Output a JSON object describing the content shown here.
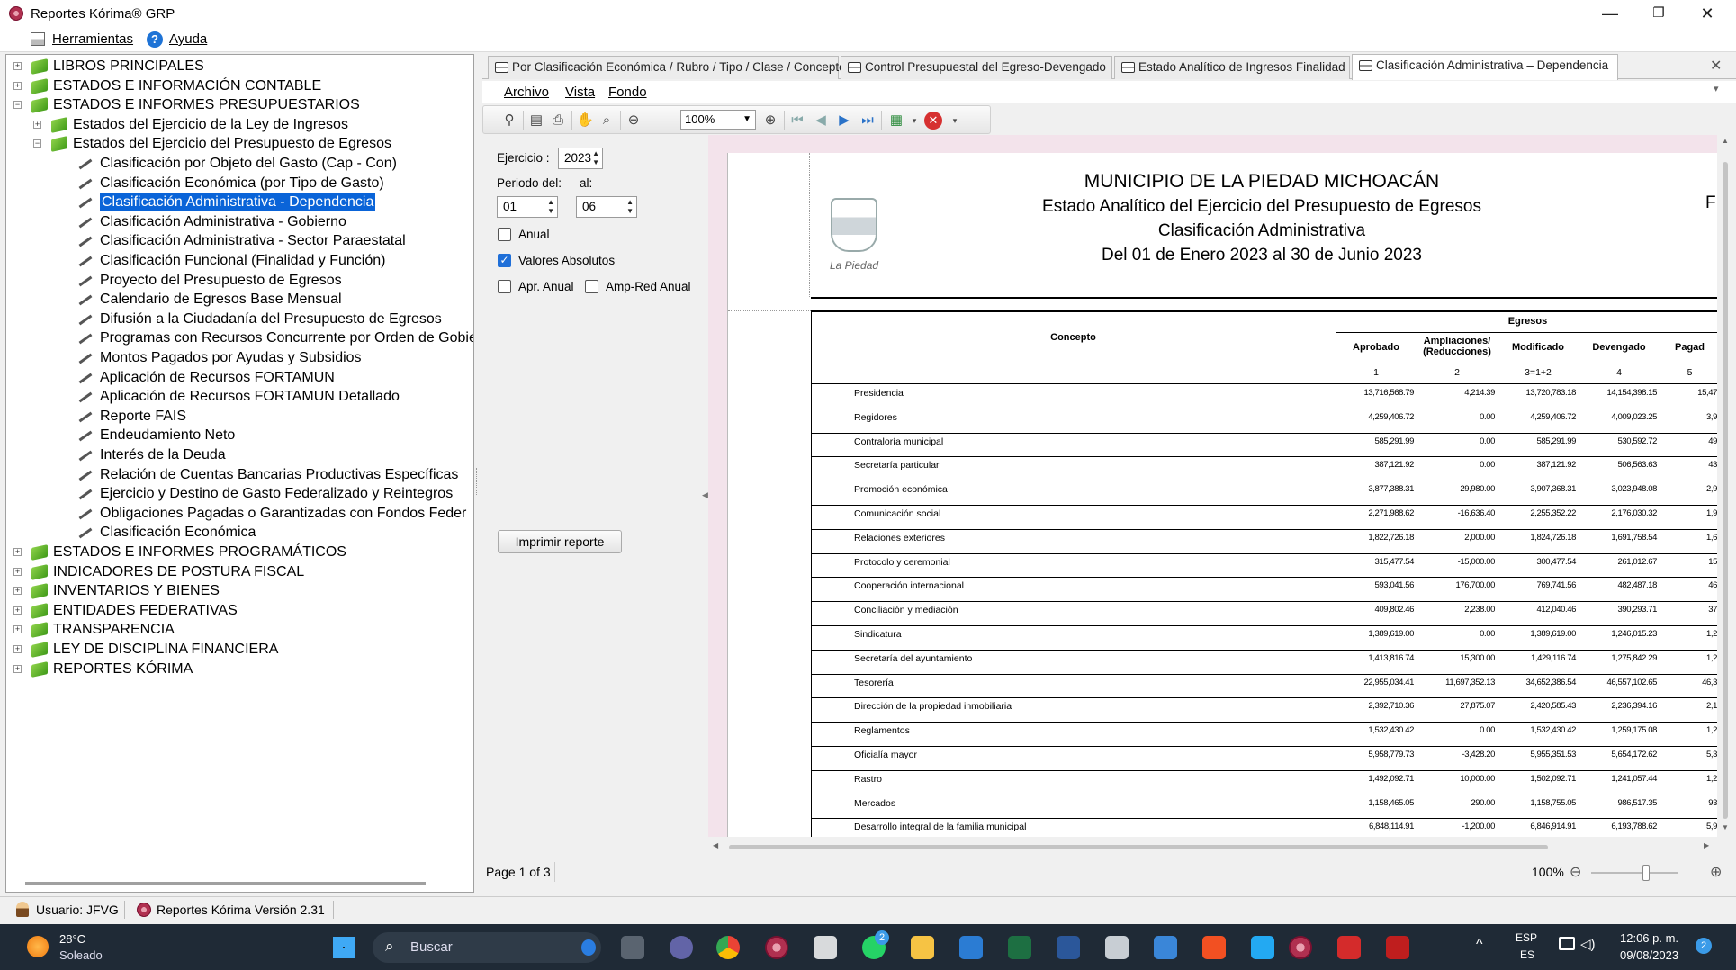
{
  "window": {
    "title": "Reportes Kórima® GRP",
    "minimize": "—",
    "maximize": "❐",
    "close": "✕"
  },
  "menu": {
    "tools": "Herramientas",
    "help": "Ayuda"
  },
  "tree": [
    {
      "label": "LIBROS PRINCIPALES",
      "level": 0,
      "expander": "+",
      "type": "book"
    },
    {
      "label": "ESTADOS E INFORMACIÓN CONTABLE",
      "level": 0,
      "expander": "+",
      "type": "book"
    },
    {
      "label": "ESTADOS E INFORMES PRESUPUESTARIOS",
      "level": 0,
      "expander": "−",
      "type": "book"
    },
    {
      "label": "Estados del Ejercicio de la Ley de Ingresos",
      "level": 1,
      "expander": "+",
      "type": "book"
    },
    {
      "label": "Estados del Ejercicio del Presupuesto de Egresos",
      "level": 1,
      "expander": "−",
      "type": "book"
    },
    {
      "label": "Clasificación por Objeto del Gasto (Cap -  Con)",
      "level": 2,
      "type": "pen"
    },
    {
      "label": "Clasificación Económica (por Tipo de Gasto)",
      "level": 2,
      "type": "pen"
    },
    {
      "label": "Clasificación Administrativa - Dependencia",
      "level": 2,
      "type": "pen",
      "selected": true
    },
    {
      "label": "Clasificación Administrativa - Gobierno",
      "level": 2,
      "type": "pen"
    },
    {
      "label": "Clasificación Administrativa - Sector Paraestatal",
      "level": 2,
      "type": "pen"
    },
    {
      "label": "Clasificación Funcional (Finalidad y Función)",
      "level": 2,
      "type": "pen"
    },
    {
      "label": "Proyecto del Presupuesto de Egresos",
      "level": 2,
      "type": "pen"
    },
    {
      "label": "Calendario de Egresos Base Mensual",
      "level": 2,
      "type": "pen"
    },
    {
      "label": "Difusión a la Ciudadanía del Presupuesto de Egresos",
      "level": 2,
      "type": "pen"
    },
    {
      "label": "Programas con Recursos Concurrente por Orden de Gobie",
      "level": 2,
      "type": "pen"
    },
    {
      "label": "Montos Pagados por Ayudas y Subsidios",
      "level": 2,
      "type": "pen"
    },
    {
      "label": "Aplicación de Recursos FORTAMUN",
      "level": 2,
      "type": "pen"
    },
    {
      "label": "Aplicación de Recursos FORTAMUN Detallado",
      "level": 2,
      "type": "pen"
    },
    {
      "label": "Reporte FAIS",
      "level": 2,
      "type": "pen"
    },
    {
      "label": "Endeudamiento Neto",
      "level": 2,
      "type": "pen"
    },
    {
      "label": "Interés de la Deuda",
      "level": 2,
      "type": "pen"
    },
    {
      "label": "Relación de Cuentas Bancarias Productivas Específicas",
      "level": 2,
      "type": "pen"
    },
    {
      "label": "Ejercicio y Destino de Gasto Federalizado y Reintegros",
      "level": 2,
      "type": "pen"
    },
    {
      "label": "Obligaciones Pagadas o Garantizadas con Fondos Feder",
      "level": 2,
      "type": "pen"
    },
    {
      "label": "Clasificación Económica",
      "level": 2,
      "type": "pen"
    },
    {
      "label": "ESTADOS E INFORMES PROGRAMÁTICOS",
      "level": 0,
      "expander": "+",
      "type": "book"
    },
    {
      "label": "INDICADORES DE POSTURA FISCAL",
      "level": 0,
      "expander": "+",
      "type": "book"
    },
    {
      "label": "INVENTARIOS Y BIENES",
      "level": 0,
      "expander": "+",
      "type": "book"
    },
    {
      "label": "ENTIDADES FEDERATIVAS",
      "level": 0,
      "expander": "+",
      "type": "book"
    },
    {
      "label": "TRANSPARENCIA",
      "level": 0,
      "expander": "+",
      "type": "book"
    },
    {
      "label": "LEY DE DISCIPLINA FINANCIERA",
      "level": 0,
      "expander": "+",
      "type": "book"
    },
    {
      "label": "REPORTES KÓRIMA",
      "level": 0,
      "expander": "+",
      "type": "book"
    }
  ],
  "tabs": [
    {
      "label": "Por Clasificación Económica / Rubro / Tipo / Clase / Concepto"
    },
    {
      "label": "Control Presupuestal del Egreso-Devengado"
    },
    {
      "label": "Estado Analítico de Ingresos Finalidad"
    },
    {
      "label": "Clasificación Administrativa – Dependencia",
      "active": true
    }
  ],
  "tab_close": "✕",
  "report_menu": {
    "file": "Archivo",
    "view": "Vista",
    "background": "Fondo"
  },
  "toolbar": {
    "zoom": "100%"
  },
  "params": {
    "ejercicio_label": "Ejercicio :",
    "ejercicio": "2023",
    "periodo_label": "Periodo del:",
    "al_label": "al:",
    "from": "01",
    "to": "06",
    "anual": "Anual",
    "valores_absolutos": "Valores Absolutos",
    "apr_anual": "Apr. Anual",
    "amp_red_anual": "Amp-Red Anual",
    "print_button": "Imprimir reporte"
  },
  "report": {
    "title": "MUNICIPIO DE LA PIEDAD MICHOACÁN",
    "subtitle": "Estado Analítico del Ejercicio del Presupuesto de Egresos",
    "classification": "Clasificación Administrativa",
    "period": "Del 01 de Enero 2023 al 30 de Junio 2023",
    "logo_text": "La Piedad",
    "edge_letter": "F",
    "concept_header": "Concepto",
    "group_header": "Egresos",
    "columns": [
      {
        "label": "Aprobado",
        "num": "1"
      },
      {
        "label": "Ampliaciones/ (Reducciones)",
        "num": "2"
      },
      {
        "label": "Modificado",
        "num": "3=1+2"
      },
      {
        "label": "Devengado",
        "num": "4"
      },
      {
        "label": "Pagad",
        "num": "5"
      }
    ],
    "rows": [
      {
        "concepto": "Presidencia",
        "v": [
          "13,716,568.79",
          "4,214.39",
          "13,720,783.18",
          "14,154,398.15",
          "15,47"
        ]
      },
      {
        "concepto": "Regidores",
        "v": [
          "4,259,406.72",
          "0.00",
          "4,259,406.72",
          "4,009,023.25",
          "3,9"
        ]
      },
      {
        "concepto": "Contraloría municipal",
        "v": [
          "585,291.99",
          "0.00",
          "585,291.99",
          "530,592.72",
          "49"
        ]
      },
      {
        "concepto": "Secretaría particular",
        "v": [
          "387,121.92",
          "0.00",
          "387,121.92",
          "506,563.63",
          "43"
        ]
      },
      {
        "concepto": "Promoción económica",
        "v": [
          "3,877,388.31",
          "29,980.00",
          "3,907,368.31",
          "3,023,948.08",
          "2,9"
        ]
      },
      {
        "concepto": "Comunicación social",
        "v": [
          "2,271,988.62",
          "-16,636.40",
          "2,255,352.22",
          "2,176,030.32",
          "1,9"
        ]
      },
      {
        "concepto": "Relaciones exteriores",
        "v": [
          "1,822,726.18",
          "2,000.00",
          "1,824,726.18",
          "1,691,758.54",
          "1,6"
        ]
      },
      {
        "concepto": "Protocolo y ceremonial",
        "v": [
          "315,477.54",
          "-15,000.00",
          "300,477.54",
          "261,012.67",
          "15"
        ]
      },
      {
        "concepto": "Cooperación internacional",
        "v": [
          "593,041.56",
          "176,700.00",
          "769,741.56",
          "482,487.18",
          "46"
        ]
      },
      {
        "concepto": "Conciliación y mediación",
        "v": [
          "409,802.46",
          "2,238.00",
          "412,040.46",
          "390,293.71",
          "37"
        ]
      },
      {
        "concepto": "Sindicatura",
        "v": [
          "1,389,619.00",
          "0.00",
          "1,389,619.00",
          "1,246,015.23",
          "1,2"
        ]
      },
      {
        "concepto": "Secretaría del ayuntamiento",
        "v": [
          "1,413,816.74",
          "15,300.00",
          "1,429,116.74",
          "1,275,842.29",
          "1,2"
        ]
      },
      {
        "concepto": "Tesorería",
        "v": [
          "22,955,034.41",
          "11,697,352.13",
          "34,652,386.54",
          "46,557,102.65",
          "46,3"
        ]
      },
      {
        "concepto": "Dirección de la propiedad inmobiliaria",
        "v": [
          "2,392,710.36",
          "27,875.07",
          "2,420,585.43",
          "2,236,394.16",
          "2,1"
        ]
      },
      {
        "concepto": "Reglamentos",
        "v": [
          "1,532,430.42",
          "0.00",
          "1,532,430.42",
          "1,259,175.08",
          "1,2"
        ]
      },
      {
        "concepto": "Oficialía mayor",
        "v": [
          "5,958,779.73",
          "-3,428.20",
          "5,955,351.53",
          "5,654,172.62",
          "5,3"
        ]
      },
      {
        "concepto": "Rastro",
        "v": [
          "1,492,092.71",
          "10,000.00",
          "1,502,092.71",
          "1,241,057.44",
          "1,2"
        ]
      },
      {
        "concepto": "Mercados",
        "v": [
          "1,158,465.05",
          "290.00",
          "1,158,755.05",
          "986,517.35",
          "93"
        ]
      },
      {
        "concepto": "Desarrollo integral de la familia municipal",
        "v": [
          "6,848,114.91",
          "-1,200.00",
          "6,846,914.91",
          "6,193,788.62",
          "5,9"
        ]
      }
    ]
  },
  "statusbar": {
    "page": "Page 1 of 3",
    "zoom": "100%"
  },
  "app_status": {
    "user": "Usuario: JFVG",
    "version": "Reportes Kórima Versión 2.31"
  },
  "taskbar": {
    "temp": "28°C",
    "weather": "Soleado",
    "search": "Buscar",
    "lang": "ESP",
    "lang2": "ES",
    "time": "12:06 p. m.",
    "date": "09/08/2023",
    "whatsapp_badge": "2",
    "notif": "2"
  }
}
